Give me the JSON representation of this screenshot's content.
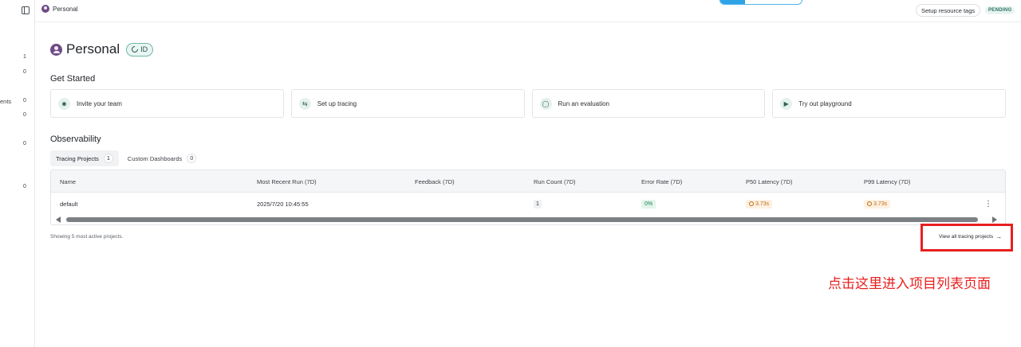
{
  "sidebar": {
    "counts": [
      "1",
      "0",
      "0",
      "0",
      "0",
      "0"
    ],
    "partial_label": "ents"
  },
  "topbar": {
    "breadcrumb": "Personal",
    "resource_button": "Setup resource tags",
    "status_badge": "PENDING",
    "progress_fraction": 0.3
  },
  "header": {
    "title": "Personal",
    "id_badge": "ID"
  },
  "get_started": {
    "heading": "Get Started",
    "cards": [
      {
        "label": "Invite your team",
        "icon": "user-icon"
      },
      {
        "label": "Set up tracing",
        "icon": "tracing-icon"
      },
      {
        "label": "Run an evaluation",
        "icon": "flask-icon"
      },
      {
        "label": "Try out playground",
        "icon": "play-icon"
      }
    ]
  },
  "observability": {
    "heading": "Observability",
    "tabs": [
      {
        "label": "Tracing Projects",
        "count": "1"
      },
      {
        "label": "Custom Dashboards",
        "count": "0"
      }
    ],
    "columns": [
      "Name",
      "Most Recent Run (7D)",
      "Feedback (7D)",
      "Run Count (7D)",
      "Error Rate (7D)",
      "P50 Latency (7D)",
      "P99 Latency (7D)"
    ],
    "rows": [
      {
        "name": "default",
        "most_recent_run": "2025/7/20 10:45:55",
        "feedback": "",
        "run_count": "1",
        "error_rate": "0%",
        "p50": "3.73s",
        "p99": "3.73s"
      }
    ],
    "footer_note": "Showing 5 most active projects.",
    "view_all_link": "View all tracing projects"
  },
  "annotation": {
    "text": "点击这里进入项目列表页面",
    "color": "#e8201f"
  },
  "colors": {
    "accent": "#2ea3e6",
    "badge_green": "#1e7a4c",
    "badge_orange": "#c06a14"
  }
}
